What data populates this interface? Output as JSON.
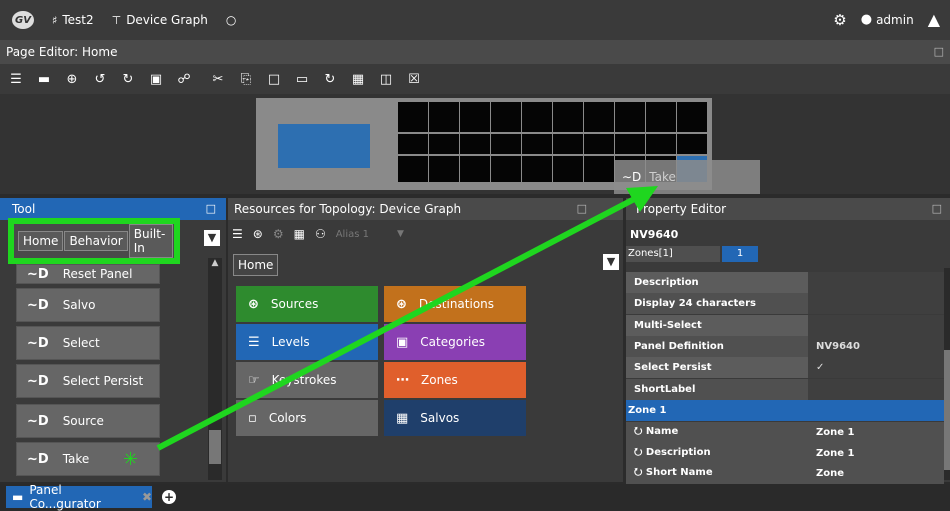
{
  "topbar": {
    "logo": "GV",
    "project_icon": "sitemap-icon",
    "project": "Test2",
    "graph_icon": "device-graph-icon",
    "graph": "Device Graph",
    "user": "admin"
  },
  "page_editor": {
    "title": "Page Editor: Home"
  },
  "drag_ghost": {
    "label": "Take"
  },
  "tool": {
    "title": "Tool",
    "breadcrumb": [
      "Home",
      "Behavior",
      "Built-In"
    ],
    "items": [
      "Reset Panel",
      "Salvo",
      "Select",
      "Select Persist",
      "Source",
      "Take"
    ]
  },
  "resources": {
    "title": "Resources for Topology: Device Graph",
    "alias": "Alias 1",
    "home": "Home",
    "tiles": [
      {
        "label": "Sources",
        "color": "#2e8b2e"
      },
      {
        "label": "Destinations",
        "color": "#c2711c"
      },
      {
        "label": "Levels",
        "color": "#2267b5"
      },
      {
        "label": "Categories",
        "color": "#8a3fb3"
      },
      {
        "label": "Keystrokes",
        "color": "#666666"
      },
      {
        "label": "Zones",
        "color": "#e05f2c"
      },
      {
        "label": "Colors",
        "color": "#666666"
      },
      {
        "label": "Salvos",
        "color": "#1f3f6b"
      }
    ]
  },
  "property_editor": {
    "title": "Property Editor",
    "device": "NV9640",
    "zones_tab": "Zones[1]",
    "zones_value": "1",
    "rows": [
      {
        "label": "Description",
        "value": ""
      },
      {
        "label": "Display 24 characters",
        "value": ""
      },
      {
        "label": "Multi-Select",
        "value": ""
      },
      {
        "label": "Panel Definition",
        "value": "NV9640"
      },
      {
        "label": "Select Persist",
        "value": "✓"
      },
      {
        "label": "ShortLabel",
        "value": ""
      }
    ],
    "zone_header": "Zone 1",
    "zone_rows": [
      {
        "label": "Name",
        "value": "Zone 1"
      },
      {
        "label": "Description",
        "value": "Zone 1"
      },
      {
        "label": "Short Name",
        "value": "Zone"
      }
    ]
  },
  "bottom": {
    "tab_label": "Panel Co...gurator"
  },
  "colors": {
    "accent": "#2267b5",
    "highlight": "#1fd61f"
  }
}
